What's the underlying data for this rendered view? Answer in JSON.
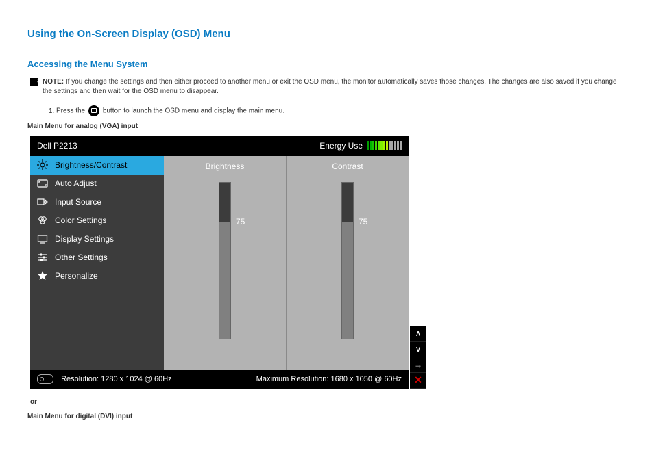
{
  "headings": {
    "main": "Using the On-Screen Display (OSD) Menu",
    "sub": "Accessing the Menu System"
  },
  "note": {
    "label": "NOTE:",
    "text": "If you change the settings and then either proceed to another menu or exit the OSD menu, the monitor automatically saves those changes. The changes are also saved if you change the settings and then wait for the OSD menu to disappear."
  },
  "step1": {
    "pre": "Press the",
    "post": "button to launch the OSD menu and display the main menu."
  },
  "captions": {
    "vga": "Main Menu for analog (VGA) input",
    "or": "or",
    "dvi": "Main Menu for digital (DVI) input"
  },
  "osd": {
    "model": "Dell P2213",
    "energy_label": "Energy Use",
    "energy_segments": [
      "#00a000",
      "#00b300",
      "#18c400",
      "#3fd800",
      "#5fe800",
      "#7ff000",
      "#9ff400",
      "#bdf400",
      "#a8a8a8",
      "#a8a8a8",
      "#a8a8a8",
      "#a8a8a8",
      "#a8a8a8"
    ],
    "menu": [
      {
        "icon": "brightness-icon",
        "label": "Brightness/Contrast",
        "selected": true
      },
      {
        "icon": "auto-adjust-icon",
        "label": "Auto Adjust"
      },
      {
        "icon": "input-source-icon",
        "label": "Input Source"
      },
      {
        "icon": "color-settings-icon",
        "label": "Color Settings"
      },
      {
        "icon": "display-settings-icon",
        "label": "Display Settings"
      },
      {
        "icon": "other-settings-icon",
        "label": "Other Settings"
      },
      {
        "icon": "personalize-icon",
        "label": "Personalize"
      }
    ],
    "sliders": {
      "brightness": {
        "label": "Brightness",
        "value": 75
      },
      "contrast": {
        "label": "Contrast",
        "value": 75
      }
    },
    "footer": {
      "resolution": "Resolution: 1280 x 1024 @ 60Hz",
      "max_resolution": "Maximum Resolution: 1680 x 1050 @ 60Hz"
    }
  },
  "side_buttons": {
    "up": "∧",
    "down": "∨",
    "enter": "→",
    "close": "✕"
  }
}
